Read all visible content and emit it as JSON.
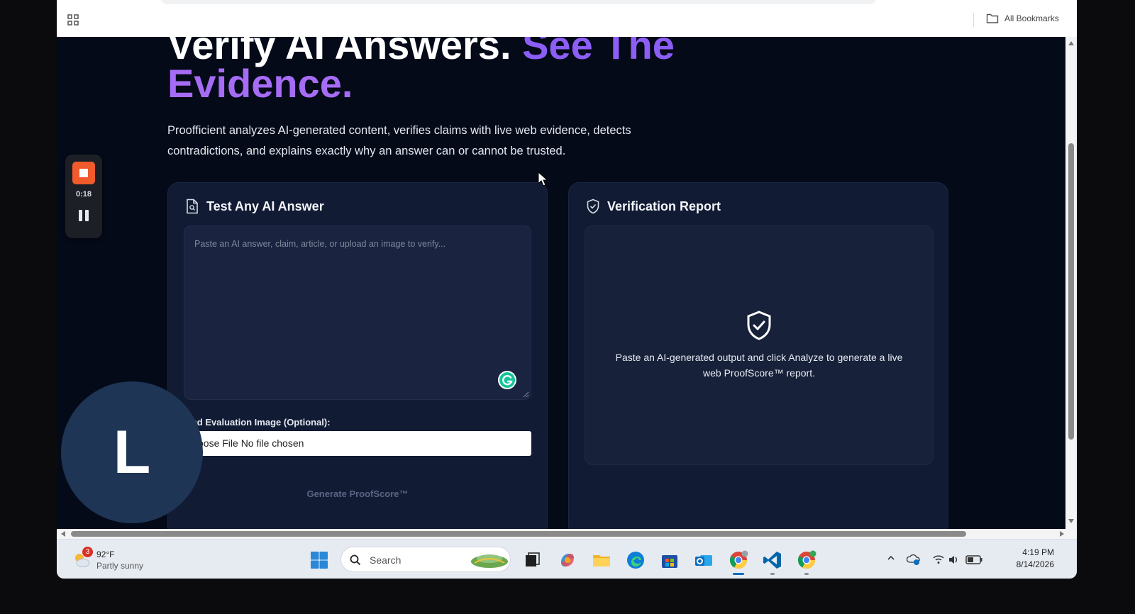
{
  "browser": {
    "bookmarks_label": "All Bookmarks"
  },
  "hero": {
    "line1_white": "Verify AI Answers.",
    "line1_accent": "See The",
    "line2": "Evidence.",
    "intro": "Proofficient analyzes AI-generated content, verifies claims with live web evidence, detects contradictions, and explains exactly why an answer can or cannot be trusted."
  },
  "test_card": {
    "title": "Test Any AI Answer",
    "textarea_placeholder": "Paste an AI answer, claim, article, or upload an image to verify...",
    "upload_label": "load Evaluation Image (Optional):",
    "file_input_text": "oose File No file chosen",
    "generate_button": "Generate ProofScore™"
  },
  "report_card": {
    "title": "Verification Report",
    "empty_message": "Paste an AI-generated output and click Analyze to generate a live web ProofScore™ report."
  },
  "recorder": {
    "elapsed": "0:18"
  },
  "avatar": {
    "initial": "L"
  },
  "taskbar": {
    "weather_badge": "3",
    "temperature": "92°F",
    "condition": "Partly sunny",
    "search_label": "Search",
    "time": "4:19 PM",
    "date": "8/14/2026",
    "apps": [
      "task-view",
      "copilot",
      "file-explorer",
      "edge",
      "microsoft-store",
      "outlook",
      "chrome",
      "vscode",
      "chrome-profile"
    ]
  },
  "colors": {
    "accent_purple": "#8c5ef6",
    "page_bg": "#050a19",
    "card_bg": "#111b33",
    "recorder_stop": "#f15a2b"
  }
}
